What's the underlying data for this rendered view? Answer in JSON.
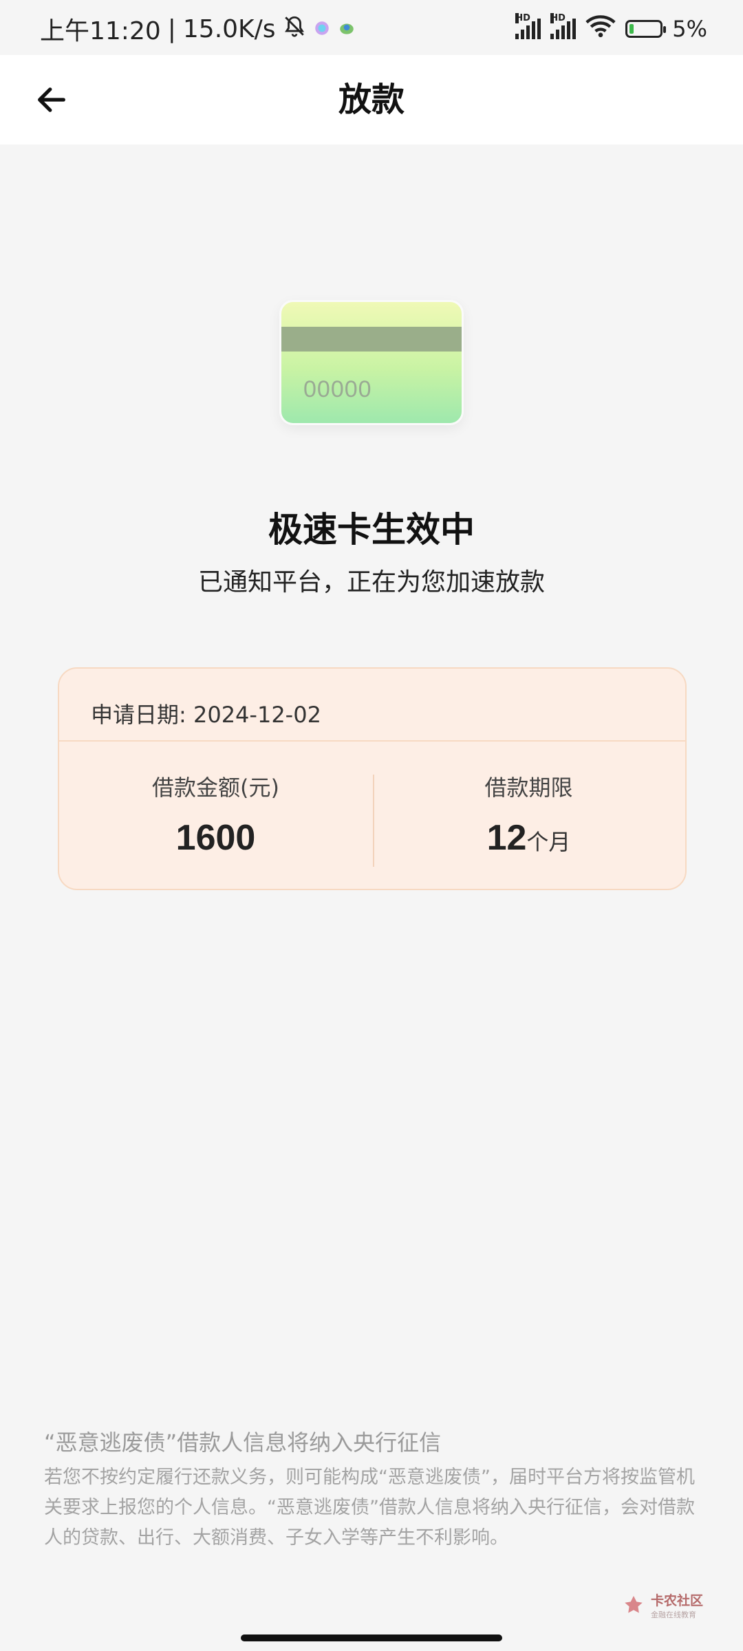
{
  "status_bar": {
    "time": "上午11:20",
    "separator": "|",
    "net_speed": "15.0K/s",
    "hd1": "HD",
    "hd2": "HD",
    "battery": "5%",
    "icons": [
      "bell-off-icon",
      "app-notification-icon",
      "app-notification-icon",
      "signal-icon",
      "signal-icon",
      "wifi-icon",
      "battery-charging-icon"
    ]
  },
  "header": {
    "title": "放款",
    "back_icon": "arrow-left-icon"
  },
  "card_illustration": {
    "number": "00000"
  },
  "status": {
    "title": "极速卡生效中",
    "subtitle": "已通知平台，正在为您加速放款"
  },
  "loan": {
    "date_label": "申请日期:",
    "date_value": "2024-12-02",
    "amount_label": "借款金额(元)",
    "amount_value": "1600",
    "term_label": "借款期限",
    "term_value": "12",
    "term_unit": "个月"
  },
  "notice": {
    "title": "“恶意逃废债”借款人信息将纳入央行征信",
    "body": "若您不按约定履行还款义务，则可能构成“恶意逃废债”，届时平台方将按监管机关要求上报您的个人信息。“恶意逃废债”借款人信息将纳入央行征信，会对借款人的贷款、出行、大额消费、子女入学等产生不利影响。"
  },
  "watermark": {
    "main": "卡农社区",
    "sub": "金融在线教育"
  },
  "colors": {
    "page_bg": "#f5f5f5",
    "card_bg": "#fdeee5",
    "card_border": "#f7d9c2"
  }
}
